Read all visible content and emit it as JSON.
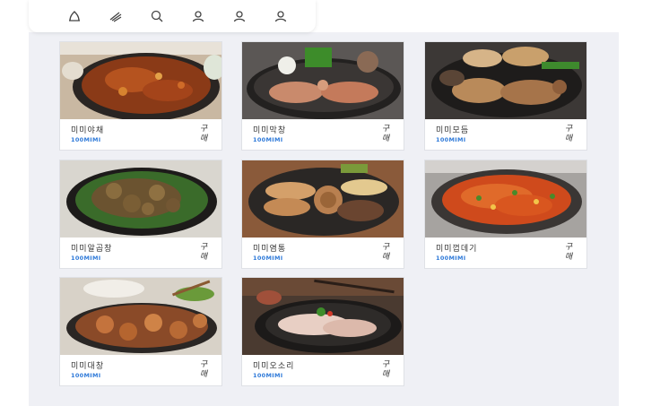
{
  "nav": {
    "icons": [
      "home-icon",
      "brand-icon",
      "search-icon",
      "user-icon",
      "user-icon",
      "user-icon"
    ]
  },
  "products": [
    {
      "name": "미미야채",
      "brand": "100MIMI",
      "buy_label": "구매",
      "photo": "stir-fried-vegetables-photo"
    },
    {
      "name": "미미막창",
      "brand": "100MIMI",
      "buy_label": "구매",
      "photo": "grilled-makchang-photo"
    },
    {
      "name": "미미모듬",
      "brand": "100MIMI",
      "buy_label": "구매",
      "photo": "assorted-grill-photo"
    },
    {
      "name": "미미알곱창",
      "brand": "100MIMI",
      "buy_label": "구매",
      "photo": "al-gopchang-photo"
    },
    {
      "name": "미미염통",
      "brand": "100MIMI",
      "buy_label": "구매",
      "photo": "yeomtong-photo"
    },
    {
      "name": "미미껍데기",
      "brand": "100MIMI",
      "buy_label": "구매",
      "photo": "pork-skin-photo"
    },
    {
      "name": "미미대창",
      "brand": "100MIMI",
      "buy_label": "구매",
      "photo": "daechang-photo"
    },
    {
      "name": "미미오소리",
      "brand": "100MIMI",
      "buy_label": "구매",
      "photo": "osori-photo"
    }
  ],
  "colors": {
    "accent": "#2f7ad9",
    "page_bg": "#eff0f5"
  }
}
